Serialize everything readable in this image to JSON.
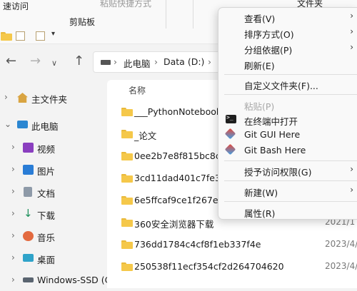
{
  "ribbon": {
    "left_text": "速访问",
    "clipboard_group": "剪贴板",
    "paste_shortcut": "粘贴快捷方式",
    "folder_label": "文件夹"
  },
  "address": {
    "segments": [
      "此电脑",
      "Data (D:)"
    ]
  },
  "sidebar": {
    "items": [
      {
        "label": "主文件夹",
        "icon": "home-icon",
        "expanded": false
      },
      {
        "label": "此电脑",
        "icon": "pc-icon",
        "expanded": true
      },
      {
        "label": "视频",
        "icon": "video-icon"
      },
      {
        "label": "图片",
        "icon": "picture-icon"
      },
      {
        "label": "文档",
        "icon": "document-icon"
      },
      {
        "label": "下载",
        "icon": "download-icon"
      },
      {
        "label": "音乐",
        "icon": "music-icon"
      },
      {
        "label": "桌面",
        "icon": "desktop-icon"
      },
      {
        "label": "Windows-SSD (C:",
        "icon": "drive-icon"
      }
    ]
  },
  "files": {
    "column_name": "名称",
    "rows": [
      {
        "name": "___PythonNotebook",
        "date": ""
      },
      {
        "name": "_论文",
        "date": ""
      },
      {
        "name": "0ee2b7e8f815bc8c72",
        "date": ""
      },
      {
        "name": "3cd11dad401c7fe3fc",
        "date": ""
      },
      {
        "name": "6e5ffcaf9ce1f267e61",
        "date": ""
      },
      {
        "name": "360安全浏览器下载",
        "date": "2021/1"
      },
      {
        "name": "736dd1784c4cf8f1eb337f4e",
        "date": "2023/4/"
      },
      {
        "name": "250538f11ecf354cf2d264704620",
        "date": "2023/4/"
      }
    ]
  },
  "context_menu": {
    "items": [
      {
        "label": "查看(V)",
        "submenu": true,
        "enabled": true
      },
      {
        "label": "排序方式(O)",
        "submenu": true,
        "enabled": true
      },
      {
        "label": "分组依据(P)",
        "submenu": true,
        "enabled": true
      },
      {
        "label": "刷新(E)",
        "submenu": false,
        "enabled": true
      },
      {
        "label": "自定义文件夹(F)...",
        "submenu": false,
        "enabled": true
      },
      {
        "label": "粘贴(P)",
        "submenu": false,
        "enabled": false
      },
      {
        "label": "在终端中打开",
        "submenu": false,
        "enabled": true,
        "icon": "terminal-icon"
      },
      {
        "label": "Git GUI Here",
        "submenu": false,
        "enabled": true,
        "icon": "git-icon"
      },
      {
        "label": "Git Bash Here",
        "submenu": false,
        "enabled": true,
        "icon": "git-icon"
      },
      {
        "label": "授予访问权限(G)",
        "submenu": true,
        "enabled": true
      },
      {
        "label": "新建(W)",
        "submenu": true,
        "enabled": true
      },
      {
        "label": "属性(R)",
        "submenu": false,
        "enabled": true
      }
    ]
  },
  "colors": {
    "folder": "#f5c84a",
    "git_icon_gradient": [
      "#e8493b",
      "#3fa0e6"
    ]
  }
}
